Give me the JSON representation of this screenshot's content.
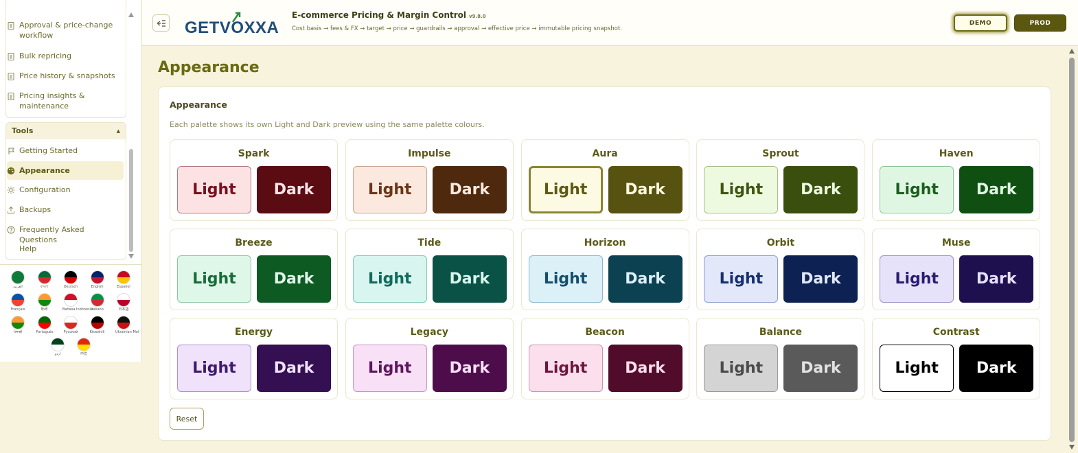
{
  "header": {
    "title": "E-commerce Pricing & Margin Control",
    "version": "v9.8.0",
    "subtitle": "Cost basis → fees & FX → target → price → guardrails → approval → effective price → immutable pricing snapshot.",
    "logo_text": "GETVOXXA",
    "env_demo": "DEMO",
    "env_prod": "PROD"
  },
  "sidebar": {
    "top_items": [
      {
        "label": "Approval & price-change workflow",
        "icon": "document-icon"
      },
      {
        "label": "Bulk repricing",
        "icon": "document-icon"
      },
      {
        "label": "Price history & snapshots",
        "icon": "document-icon"
      },
      {
        "label": "Pricing insights & maintenance",
        "icon": "document-icon"
      }
    ],
    "tools_title": "Tools",
    "tools_items": [
      {
        "label": "Getting Started",
        "icon": "flag-icon"
      },
      {
        "label": "Appearance",
        "icon": "palette-icon"
      },
      {
        "label": "Configuration",
        "icon": "gear-icon"
      },
      {
        "label": "Backups",
        "icon": "upload-icon"
      },
      {
        "label": "Frequently Asked Questions",
        "icon": "question-icon"
      },
      {
        "label": "Help",
        "icon": ""
      }
    ],
    "languages": [
      {
        "label": "العربية",
        "c1": "#0f7a3a",
        "c2": "#0f7a3a"
      },
      {
        "label": "বাংলা",
        "c1": "#0a6a3a",
        "c2": "#d42a2a"
      },
      {
        "label": "Deutsch",
        "c1": "#000000",
        "c2": "#dd0000"
      },
      {
        "label": "English",
        "c1": "#012169",
        "c2": "#c8102e"
      },
      {
        "label": "Español",
        "c1": "#c60b1e",
        "c2": "#ffc400"
      },
      {
        "label": "Français",
        "c1": "#0055a4",
        "c2": "#ef4135"
      },
      {
        "label": "हिन्दी",
        "c1": "#ff9933",
        "c2": "#138808"
      },
      {
        "label": "Bahasa Indonesia",
        "c1": "#ce1126",
        "c2": "#ffffff"
      },
      {
        "label": "Italiano",
        "c1": "#009246",
        "c2": "#ce2b37"
      },
      {
        "label": "日本語",
        "c1": "#ffffff",
        "c2": "#bc002d"
      },
      {
        "label": "ਪੰਜਾਬੀ",
        "c1": "#ff9933",
        "c2": "#138808"
      },
      {
        "label": "Português",
        "c1": "#006600",
        "c2": "#ff0000"
      },
      {
        "label": "Русский",
        "c1": "#ffffff",
        "c2": "#d52b1e"
      },
      {
        "label": "Kiswahili",
        "c1": "#000000",
        "c2": "#bb0000"
      },
      {
        "label": "Ukrainian Mol",
        "c1": "#111111",
        "c2": "#cc1111"
      },
      {
        "label": "اردو",
        "c1": "#01411c",
        "c2": "#ffffff"
      },
      {
        "label": "中文",
        "c1": "#de2910",
        "c2": "#ffde00"
      }
    ]
  },
  "main": {
    "page_title": "Appearance",
    "card_title": "Appearance",
    "card_desc": "Each palette shows its own Light and Dark preview using the same palette colours.",
    "light_label": "Light",
    "dark_label": "Dark",
    "reset_label": "Reset",
    "palettes": [
      {
        "name": "Spark",
        "name_color": "#5b5a18",
        "light_bg": "#fde2e4",
        "light_fg": "#7a0f1f",
        "light_border": "#b27a80",
        "dark_bg": "#5a0c12",
        "dark_fg": "#fbe3e5",
        "dark_border": "#5a0c12"
      },
      {
        "name": "Impulse",
        "name_color": "#5b5a18",
        "light_bg": "#fbe9df",
        "light_fg": "#6b3518",
        "light_border": "#c9a690",
        "dark_bg": "#4e290e",
        "dark_fg": "#fbe9df",
        "dark_border": "#4e290e"
      },
      {
        "name": "Aura",
        "name_color": "#5b5a18",
        "light_bg": "#fdfae3",
        "light_fg": "#5e5a14",
        "light_border": "#8a8530",
        "dark_bg": "#57520f",
        "dark_fg": "#fdf8de",
        "dark_border": "#57520f"
      },
      {
        "name": "Sprout",
        "name_color": "#5b5a18",
        "light_bg": "#eefadf",
        "light_fg": "#3d5712",
        "light_border": "#a6be8a",
        "dark_bg": "#3a4f0e",
        "dark_fg": "#eefadf",
        "dark_border": "#3a4f0e"
      },
      {
        "name": "Haven",
        "name_color": "#5b5a18",
        "light_bg": "#dff7e2",
        "light_fg": "#1b5e20",
        "light_border": "#8fc599",
        "dark_bg": "#0f5012",
        "dark_fg": "#dff7e2",
        "dark_border": "#0f5012"
      },
      {
        "name": "Breeze",
        "name_color": "#5b5a18",
        "light_bg": "#dff7e8",
        "light_fg": "#1a6b3a",
        "light_border": "#8fc5a3",
        "dark_bg": "#0e5a23",
        "dark_fg": "#dff7e8",
        "dark_border": "#0e5a23"
      },
      {
        "name": "Tide",
        "name_color": "#5b5a18",
        "light_bg": "#d9f5ef",
        "light_fg": "#126a5c",
        "light_border": "#86c6b8",
        "dark_bg": "#0b5246",
        "dark_fg": "#d9f5ef",
        "dark_border": "#0b5246"
      },
      {
        "name": "Horizon",
        "name_color": "#5b5a18",
        "light_bg": "#dcf0f8",
        "light_fg": "#154f6e",
        "light_border": "#8bb6cc",
        "dark_bg": "#0c4152",
        "dark_fg": "#dcf0f8",
        "dark_border": "#0c4152"
      },
      {
        "name": "Orbit",
        "name_color": "#5b5a18",
        "light_bg": "#e2e8fa",
        "light_fg": "#152f6e",
        "light_border": "#8e9dcc",
        "dark_bg": "#0d2152",
        "dark_fg": "#e2e8fa",
        "dark_border": "#0d2152"
      },
      {
        "name": "Muse",
        "name_color": "#5b5a18",
        "light_bg": "#e5e2fa",
        "light_fg": "#2a1c6e",
        "light_border": "#9c92cc",
        "dark_bg": "#1e0f4f",
        "dark_fg": "#e5e2fa",
        "dark_border": "#1e0f4f"
      },
      {
        "name": "Energy",
        "name_color": "#5b5a18",
        "light_bg": "#efe2fa",
        "light_fg": "#3f1a6e",
        "light_border": "#ad92cc",
        "dark_bg": "#340f52",
        "dark_fg": "#efe2fa",
        "dark_border": "#340f52"
      },
      {
        "name": "Legacy",
        "name_color": "#5b5a18",
        "light_bg": "#f8e0f7",
        "light_fg": "#5e165c",
        "light_border": "#c495c2",
        "dark_bg": "#4d0d4b",
        "dark_fg": "#f8e0f7",
        "dark_border": "#4d0d4b"
      },
      {
        "name": "Beacon",
        "name_color": "#5b5a18",
        "light_bg": "#fbdfec",
        "light_fg": "#6e1640",
        "light_border": "#cc93ad",
        "dark_bg": "#520c2b",
        "dark_fg": "#fbdfec",
        "dark_border": "#520c2b"
      },
      {
        "name": "Balance",
        "name_color": "#5b5a18",
        "light_bg": "#d4d4d4",
        "light_fg": "#4a4a4a",
        "light_border": "#9a9a9a",
        "dark_bg": "#5a5a5a",
        "dark_fg": "#e2e2e2",
        "dark_border": "#5a5a5a"
      },
      {
        "name": "Contrast",
        "name_color": "#5b5a18",
        "light_bg": "#ffffff",
        "light_fg": "#000000",
        "light_border": "#000000",
        "dark_bg": "#000000",
        "dark_fg": "#ffffff",
        "dark_border": "#000000"
      }
    ]
  }
}
